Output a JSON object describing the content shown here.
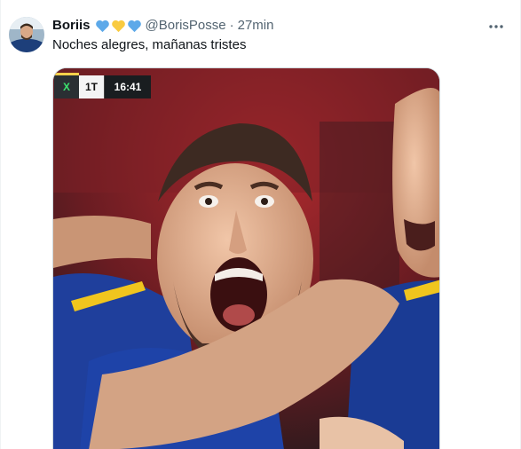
{
  "tweet": {
    "display_name": "Boriis",
    "handle": "@BorisPosse",
    "separator": "·",
    "timestamp": "27min",
    "text": "Noches alegres, mañanas tristes",
    "more_icon": "more-horizontal-icon",
    "name_emoji": [
      "blue-heart",
      "yellow-heart",
      "blue-heart"
    ]
  },
  "media": {
    "scoreboard": {
      "team": "X",
      "period": "1T",
      "clock": "16:41"
    }
  },
  "colors": {
    "text_primary": "#0f1419",
    "text_secondary": "#536471",
    "blue_heart": "#5da9e9",
    "yellow_heart": "#f9cb40"
  }
}
